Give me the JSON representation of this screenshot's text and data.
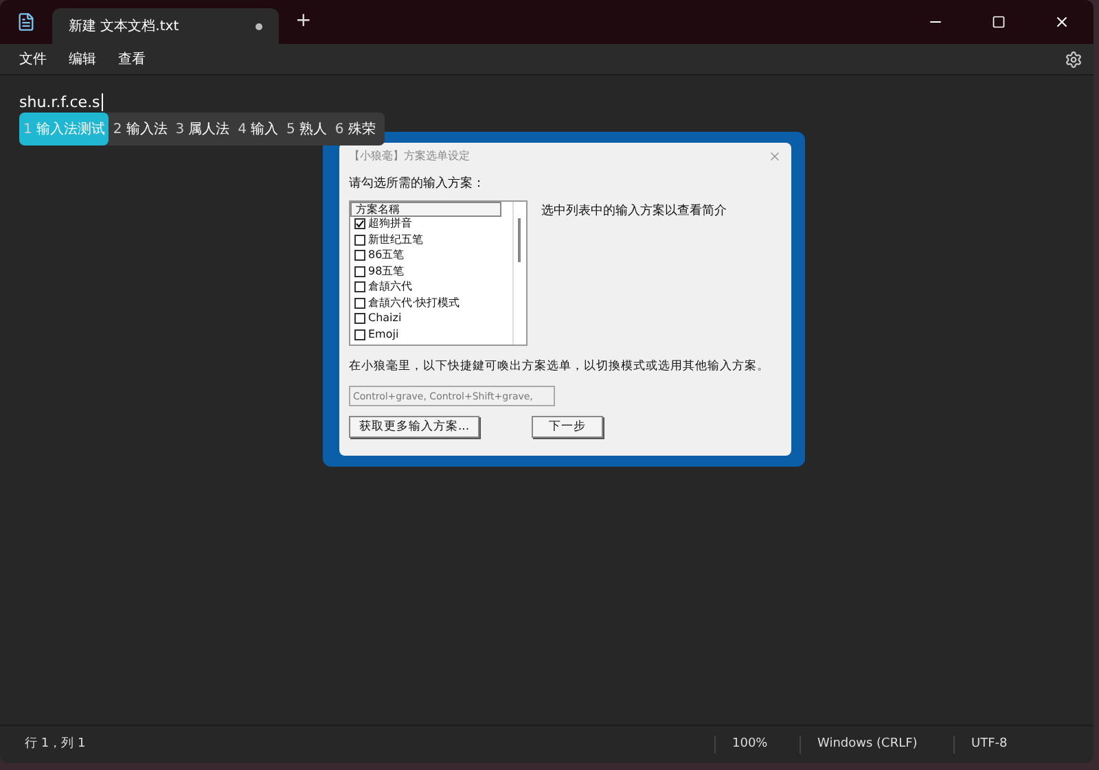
{
  "window": {
    "tab_title": "新建 文本文档.txt",
    "tab_modified": true,
    "new_tab": "+"
  },
  "menu": [
    "文件",
    "编辑",
    "查看"
  ],
  "editor": {
    "text": "shu.r.f.ce.s"
  },
  "candidates": [
    {
      "index": "1",
      "text": "输入法测试",
      "selected": true
    },
    {
      "index": "2",
      "text": "输入法",
      "selected": false
    },
    {
      "index": "3",
      "text": "属人法",
      "selected": false
    },
    {
      "index": "4",
      "text": "输入",
      "selected": false
    },
    {
      "index": "5",
      "text": "熟人",
      "selected": false
    },
    {
      "index": "6",
      "text": "殊荣",
      "selected": false
    }
  ],
  "dialog": {
    "title": "【小狼毫】方案选单设定",
    "prompt": "请勾选所需的输入方案：",
    "column": "方案名稱",
    "schemas": [
      {
        "name": "超狗拼音",
        "checked": true
      },
      {
        "name": "新世纪五笔",
        "checked": false
      },
      {
        "name": "86五笔",
        "checked": false
      },
      {
        "name": "98五笔",
        "checked": false
      },
      {
        "name": "倉頡六代",
        "checked": false
      },
      {
        "name": "倉頡六代·快打模式",
        "checked": false
      },
      {
        "name": "Chaizi",
        "checked": false
      },
      {
        "name": "Emoji",
        "checked": false
      }
    ],
    "description": "选中列表中的输入方案以查看简介",
    "hint": "在小狼毫里，以下快捷鍵可喚出方案选单，以切換模式或选用其他输入方案。",
    "hotkeys": "Control+grave, Control+Shift+grave,",
    "buttons": [
      "获取更多输入方案...",
      "下一步"
    ]
  },
  "status_bar": {
    "position": "行 1，列 1",
    "zoom": "100%",
    "line_ending": "Windows (CRLF)",
    "encoding": "UTF-8"
  }
}
